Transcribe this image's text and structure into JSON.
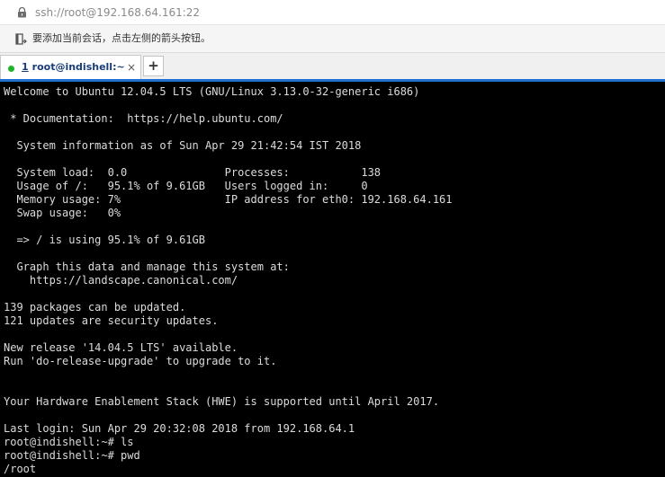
{
  "address_bar": {
    "icon": "lock-icon",
    "url": "ssh://root@192.168.64.161:22"
  },
  "hint_bar": {
    "icon": "add-session-icon",
    "text": "要添加当前会话，点击左侧的箭头按钮。"
  },
  "tabs": [
    {
      "index": "1",
      "label": "root@indishell:~",
      "status": "connected",
      "status_color": "#1eb52c",
      "active": true,
      "close_label": "×"
    }
  ],
  "new_tab_label": "+",
  "colors": {
    "terminal_bg": "#000000",
    "terminal_fg": "#dcdcdc",
    "tab_accent": "#1e6fd0",
    "tab_label": "#1a3d78"
  },
  "terminal": {
    "lines": [
      "Welcome to Ubuntu 12.04.5 LTS (GNU/Linux 3.13.0-32-generic i686)",
      "",
      " * Documentation:  https://help.ubuntu.com/",
      "",
      "  System information as of Sun Apr 29 21:42:54 IST 2018",
      "",
      "  System load:  0.0               Processes:           138",
      "  Usage of /:   95.1% of 9.61GB   Users logged in:     0",
      "  Memory usage: 7%                IP address for eth0: 192.168.64.161",
      "  Swap usage:   0%",
      "",
      "  => / is using 95.1% of 9.61GB",
      "",
      "  Graph this data and manage this system at:",
      "    https://landscape.canonical.com/",
      "",
      "139 packages can be updated.",
      "121 updates are security updates.",
      "",
      "New release '14.04.5 LTS' available.",
      "Run 'do-release-upgrade' to upgrade to it.",
      "",
      "",
      "Your Hardware Enablement Stack (HWE) is supported until April 2017.",
      "",
      "Last login: Sun Apr 29 20:32:08 2018 from 192.168.64.1",
      "root@indishell:~# ls",
      "root@indishell:~# pwd",
      "/root"
    ]
  }
}
